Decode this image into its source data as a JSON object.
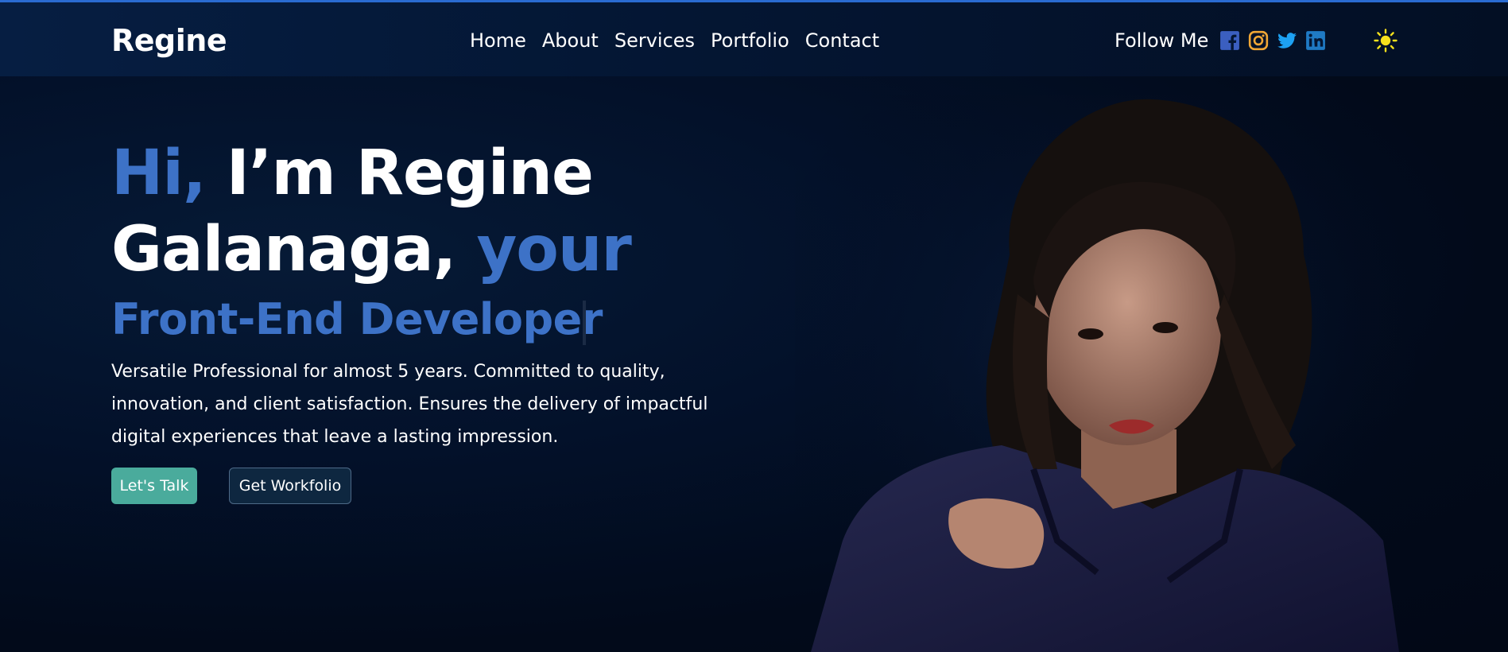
{
  "navbar": {
    "brand": "Regine",
    "links": [
      "Home",
      "About",
      "Services",
      "Portfolio",
      "Contact"
    ],
    "follow_label": "Follow Me",
    "social_icons": [
      "facebook-icon",
      "instagram-icon",
      "twitter-icon",
      "linkedin-icon"
    ],
    "theme_icon": "sun-icon"
  },
  "hero": {
    "greeting": "Hi,",
    "name_line1": " I’m Regine",
    "name_line2": "Galanaga,",
    "your": " your",
    "role": "Front-End Developer",
    "intro": "Versatile Professional for almost 5 years. Committed to quality, innovation, and client satisfaction. Ensures the delivery of impactful digital experiences that leave a lasting impression.",
    "primary_button": "Let's Talk",
    "secondary_button": "Get Workfolio"
  },
  "colors": {
    "accent": "#3d72c7",
    "primary_button_bg": "#4aab9c",
    "secondary_button_bg": "#0e2740",
    "background": "#020917",
    "facebook": "#3b5fc0",
    "instagram": "#f0a635",
    "twitter": "#1da1f2",
    "linkedin": "#1f7ac4",
    "sun": "#f7e01c"
  }
}
